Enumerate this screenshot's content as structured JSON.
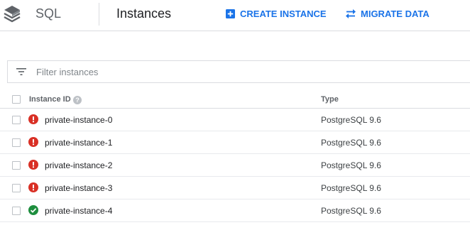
{
  "header": {
    "product": "SQL",
    "title": "Instances",
    "actions": {
      "create": "CREATE INSTANCE",
      "migrate": "MIGRATE DATA"
    }
  },
  "filter": {
    "placeholder": "Filter instances"
  },
  "table": {
    "columns": {
      "id": "Instance ID",
      "type": "Type"
    },
    "rows": [
      {
        "name": "private-instance-0",
        "type": "PostgreSQL 9.6",
        "status": "error"
      },
      {
        "name": "private-instance-1",
        "type": "PostgreSQL 9.6",
        "status": "error"
      },
      {
        "name": "private-instance-2",
        "type": "PostgreSQL 9.6",
        "status": "error"
      },
      {
        "name": "private-instance-3",
        "type": "PostgreSQL 9.6",
        "status": "error"
      },
      {
        "name": "private-instance-4",
        "type": "PostgreSQL 9.6",
        "status": "ok"
      }
    ]
  },
  "colors": {
    "accent": "#1a73e8",
    "error": "#d93025",
    "ok": "#1e8e3e"
  },
  "icons": {
    "logo": "cloud-sql-icon",
    "create": "add-box-icon",
    "migrate": "swap-arrows-icon",
    "filter": "filter-list-icon",
    "help": "help-icon",
    "error": "error-icon",
    "ok": "check-circle-icon"
  }
}
